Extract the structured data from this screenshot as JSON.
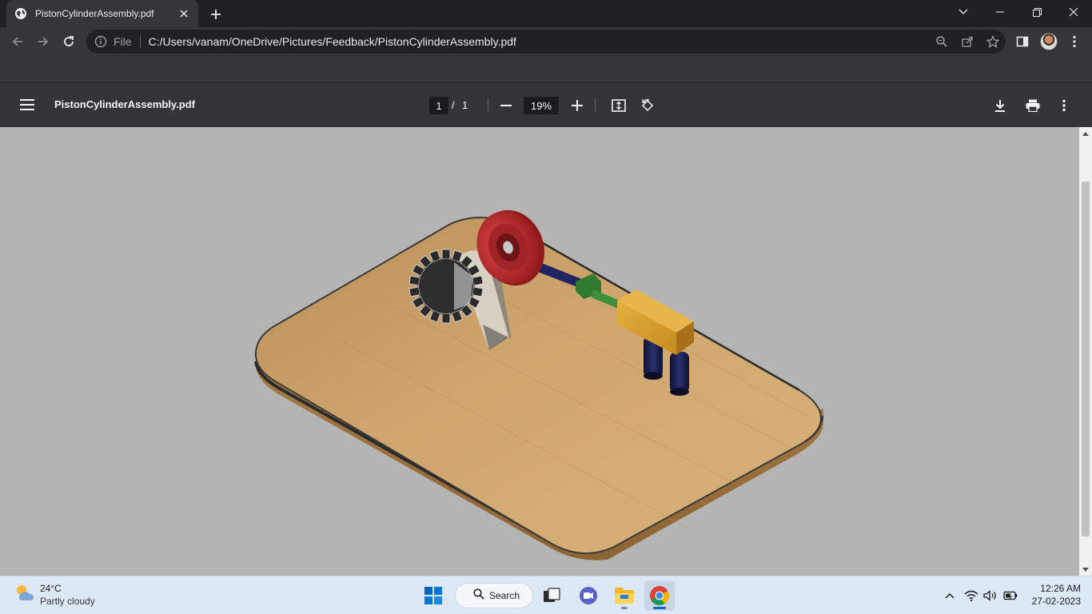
{
  "browser": {
    "tab": {
      "title": "PistonCylinderAssembly.pdf"
    },
    "omnibox": {
      "scheme_label": "File",
      "url": "C:/Users/vanam/OneDrive/Pictures/Feedback/PistonCylinderAssembly.pdf"
    }
  },
  "pdf_viewer": {
    "title": "PistonCylinderAssembly.pdf",
    "page_current": "1",
    "page_separator": "/",
    "page_total": "1",
    "zoom": "19%"
  },
  "taskbar": {
    "weather": {
      "temperature": "24°C",
      "condition": "Partly cloudy"
    },
    "search_label": "Search",
    "clock": {
      "time": "12:26 AM",
      "date": "27-02-2023"
    }
  },
  "colors": {
    "tab_bar": "#202124",
    "toolbar": "#35363a",
    "pdf_toolbar": "#323639",
    "viewer_bg": "#b4b4b4",
    "taskbar": "#dce8f5",
    "wood": "#c9a16a",
    "flywheel": "#c0282b",
    "block": "#d49a2a",
    "rods": "#1c2050"
  }
}
